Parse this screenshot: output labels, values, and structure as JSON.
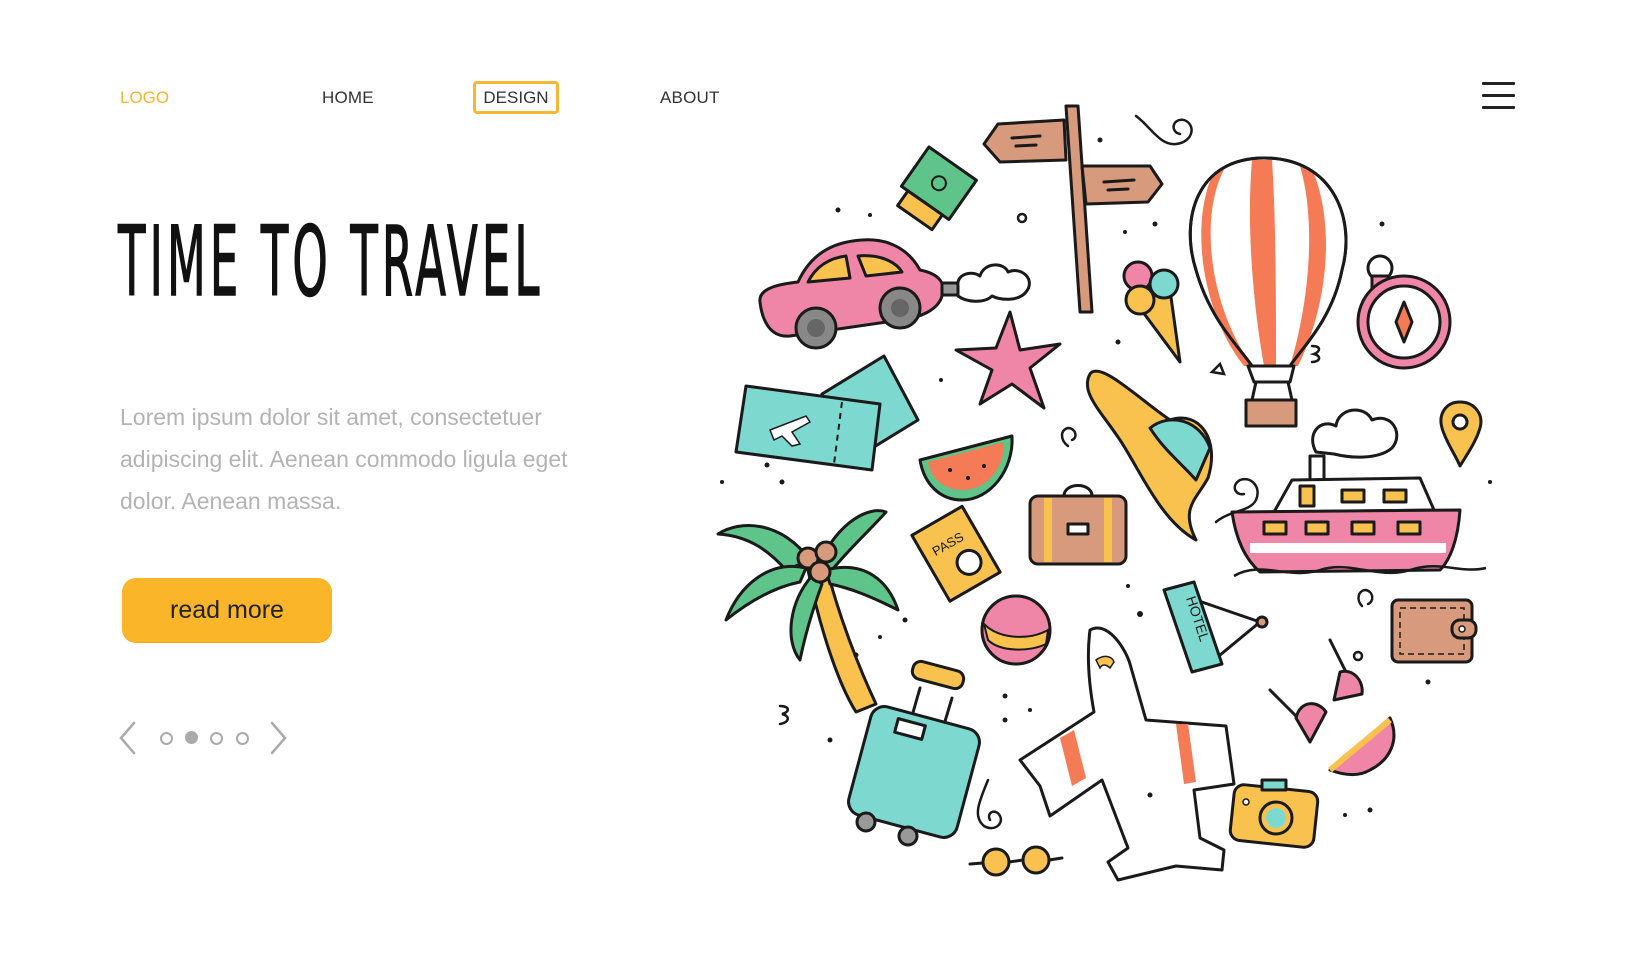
{
  "header": {
    "logo": "LOGO",
    "nav": [
      {
        "label": "HOME",
        "active": false
      },
      {
        "label": "DESIGN",
        "active": true
      },
      {
        "label": "ABOUT",
        "active": false
      }
    ],
    "menu_icon": "hamburger-menu-icon"
  },
  "hero": {
    "title": "TIME TO TRAVEL",
    "paragraph": "Lorem ipsum dolor sit amet, consectetuer adipiscing elit. Aenean commodo ligula eget dolor. Aenean massa.",
    "cta_label": "read more"
  },
  "pager": {
    "prev_icon": "chevron-left-icon",
    "next_icon": "chevron-right-icon",
    "total": 4,
    "current": 2
  },
  "illustration": {
    "hotel_sign_text": "HOTEL",
    "passport_text": "PASS",
    "items": [
      "signpost",
      "sunscreen",
      "hot-air-balloon",
      "car",
      "ice-cream",
      "compass",
      "starfish",
      "plane-tickets",
      "sun-hat",
      "watermelon",
      "location-pin",
      "ship",
      "palm-tree",
      "passport",
      "suitcase",
      "hotel-sign",
      "beach-ball",
      "airplane",
      "wallet",
      "bikini",
      "rolling-luggage",
      "camera",
      "sunglasses"
    ]
  },
  "colors": {
    "accent": "#FBB529",
    "logo": "#F2B630",
    "text": "#333333",
    "muted": "#B3B3B3",
    "pink": "#EF86A8",
    "teal": "#7DD9D0",
    "orange": "#F47B56",
    "brown": "#D89A7C",
    "yellow": "#F9C24F",
    "green": "#5FC48A"
  }
}
